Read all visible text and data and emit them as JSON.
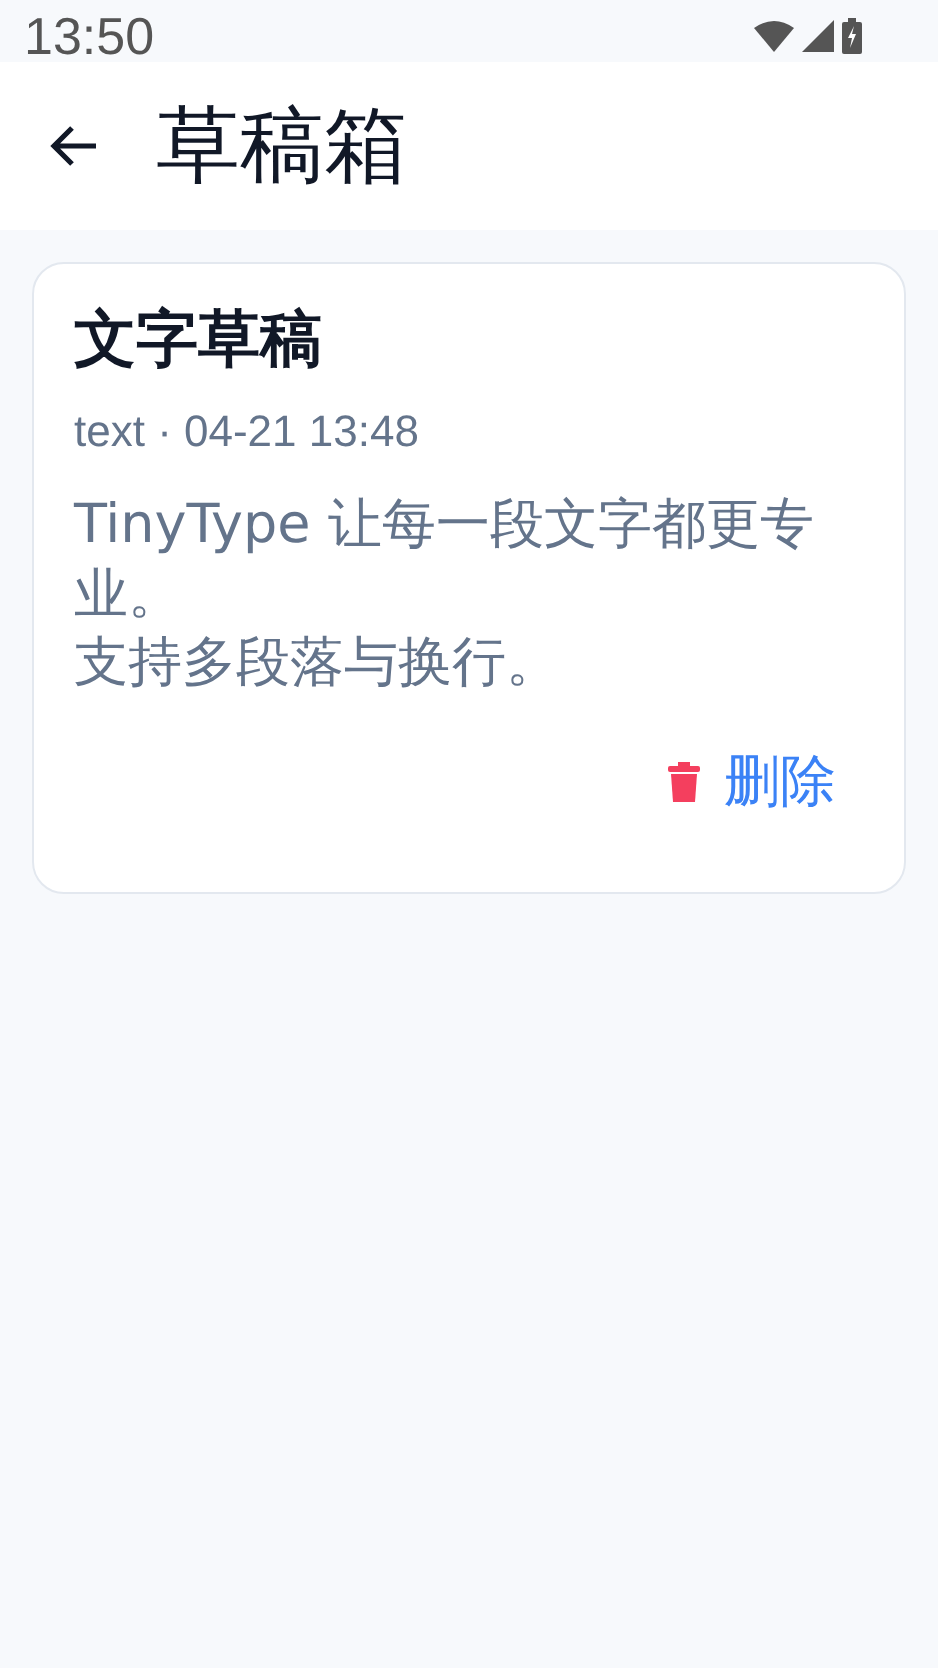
{
  "status_bar": {
    "time": "13:50"
  },
  "app_bar": {
    "title": "草稿箱"
  },
  "drafts": [
    {
      "title": "文字草稿",
      "meta": "text · 04-21 13:48",
      "body_lines": [
        "TinyType 让每一段文字都更专业。",
        "支持多段落与换行。"
      ],
      "delete_label": "删除"
    }
  ]
}
